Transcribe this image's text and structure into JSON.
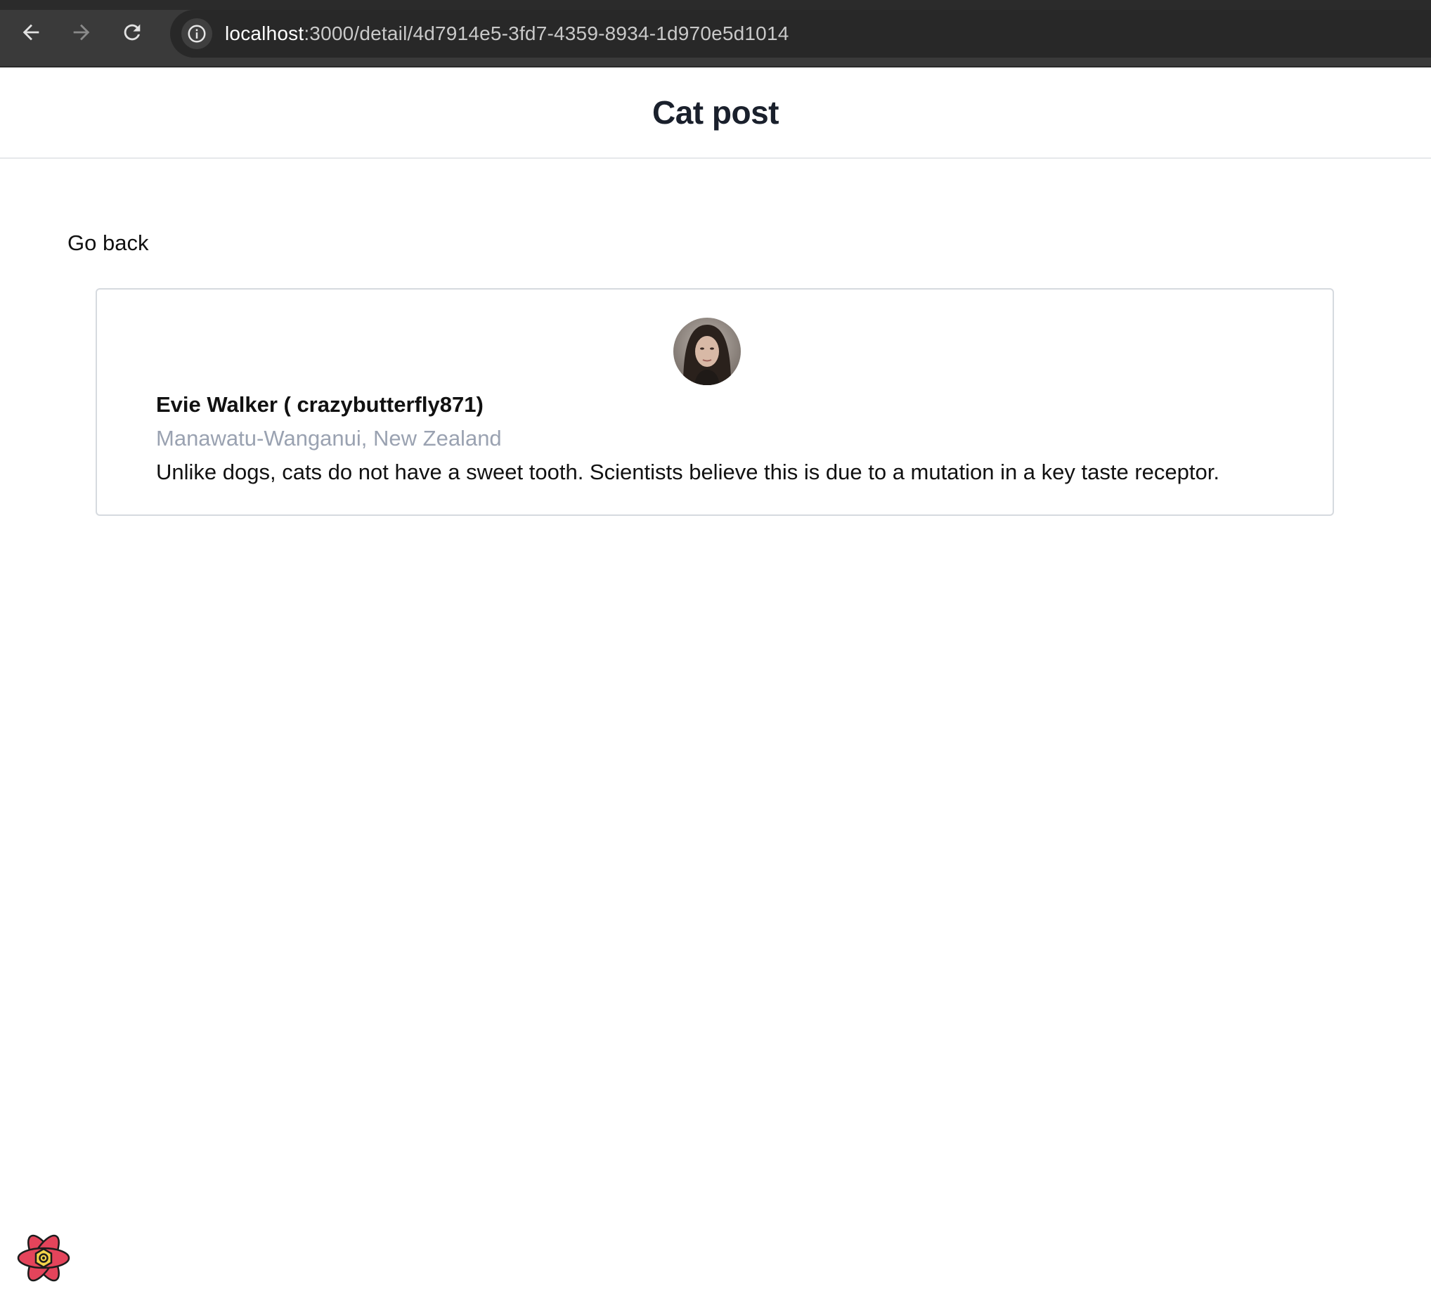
{
  "browser": {
    "url_host": "localhost",
    "url_path": ":3000/detail/4d7914e5-3fd7-4359-8934-1d970e5d1014",
    "icons": [
      "back-arrow-icon",
      "forward-arrow-icon",
      "reload-icon",
      "site-info-icon"
    ]
  },
  "header": {
    "title": "Cat post"
  },
  "nav": {
    "go_back_label": "Go back"
  },
  "post": {
    "author": "Evie Walker ( crazybutterfly871)",
    "location": "Manawatu-Wanganui, New Zealand",
    "body": "Unlike dogs, cats do not have a sweet tooth. Scientists believe this is due to a mutation in a key taste receptor."
  },
  "colors": {
    "title": "#1a202c",
    "location": "#9aa2b1",
    "card_border": "#d6dadf",
    "react_logo_red": "#e4445b",
    "react_logo_yellow": "#f3d34a"
  }
}
